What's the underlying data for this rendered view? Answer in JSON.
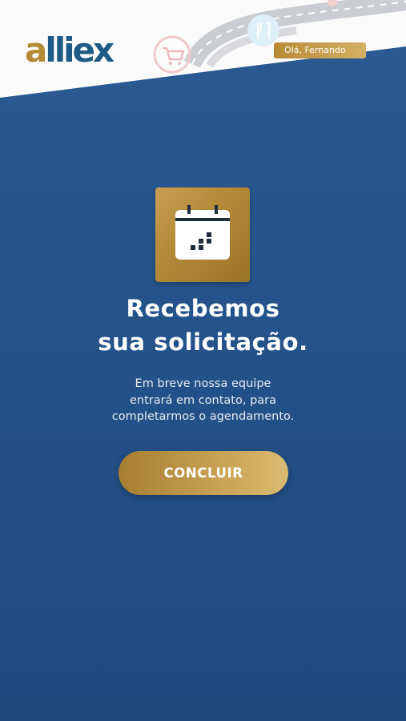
{
  "header": {
    "logo_first_letter": "a",
    "logo_rest": "lliex",
    "greeting": "Olá, Fernando"
  },
  "confirmation": {
    "icon": "calendar-icon",
    "title_line1": "Recebemos",
    "title_line2": "sua solicitação.",
    "message_line1": "Em breve nossa equipe",
    "message_line2": "entrará em contato, para",
    "message_line3": "completarmos o agendamento."
  },
  "actions": {
    "conclude_label": "CONCLUIR"
  },
  "colors": {
    "background_blue": "#24528a",
    "gold": "#b58a37",
    "logo_blue": "#1d5a86"
  }
}
